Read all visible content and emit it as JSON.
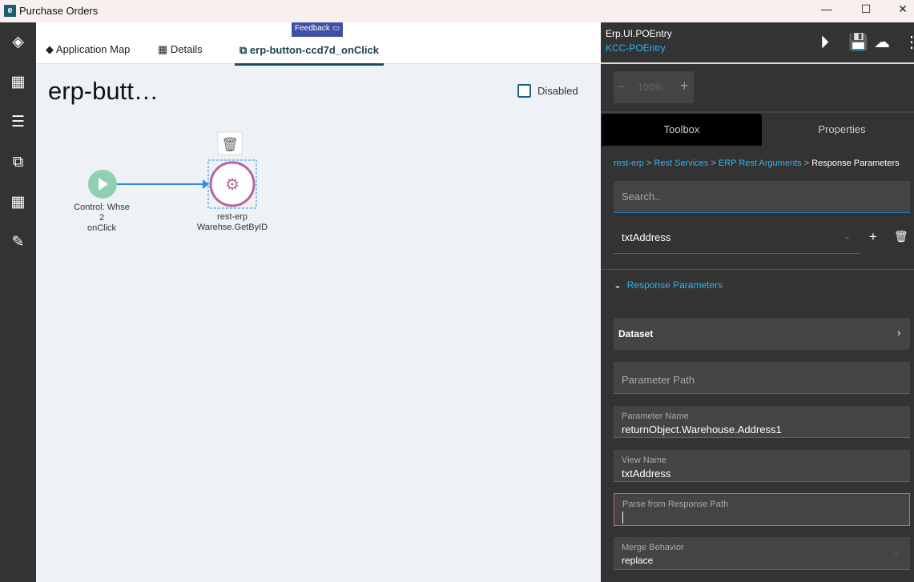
{
  "window": {
    "title": "Purchase Orders",
    "logo": "e",
    "controls": [
      "minimize",
      "maximize",
      "close"
    ]
  },
  "sidebar": {
    "icons": [
      "layers-icon",
      "layout-icon",
      "checklist-icon",
      "flow-icon",
      "grid-icon",
      "edit-doc-icon"
    ]
  },
  "tabs": [
    {
      "label": "Application Map",
      "icon": "layers-icon"
    },
    {
      "label": "Details",
      "icon": "layout-icon"
    },
    {
      "label": "erp-button-ccd7d_onClick",
      "icon": "flow-icon",
      "active": true
    }
  ],
  "feedback": {
    "label": "Feedback"
  },
  "canvas": {
    "heading": "erp-butt…",
    "disabled_label": "Disabled",
    "disabled_checked": false,
    "start_node": {
      "lines": [
        "Control: Whse",
        "2",
        "onClick"
      ],
      "color": "#8fd0b4"
    },
    "rest_node": {
      "lines": [
        "rest-erp",
        "Warehse.GetByID"
      ],
      "color": "#b5679a"
    }
  },
  "panel": {
    "app_name": "Erp.UI.POEntry",
    "layer_name": "KCC-POEntry",
    "zoom": "100%",
    "tabs": [
      "Toolbox",
      "Properties"
    ],
    "breadcrumb": [
      "rest-erp",
      "Rest Services",
      "ERP Rest Arguments",
      "Response Parameters"
    ],
    "search_placeholder": "Search..",
    "selected_view": "txtAddress",
    "section_title": "Response Parameters",
    "dataset_label": "Dataset",
    "parameter_path_placeholder": "Parameter Path",
    "parameter_name_label": "Parameter Name",
    "parameter_name_value": "returnObject.Warehouse.Address1",
    "view_name_label": "View Name",
    "view_name_value": "txtAddress",
    "parse_label": "Parse from Response Path",
    "parse_value": "",
    "merge_label": "Merge Behavior",
    "merge_value": "replace",
    "accent": "#29b6f6"
  }
}
